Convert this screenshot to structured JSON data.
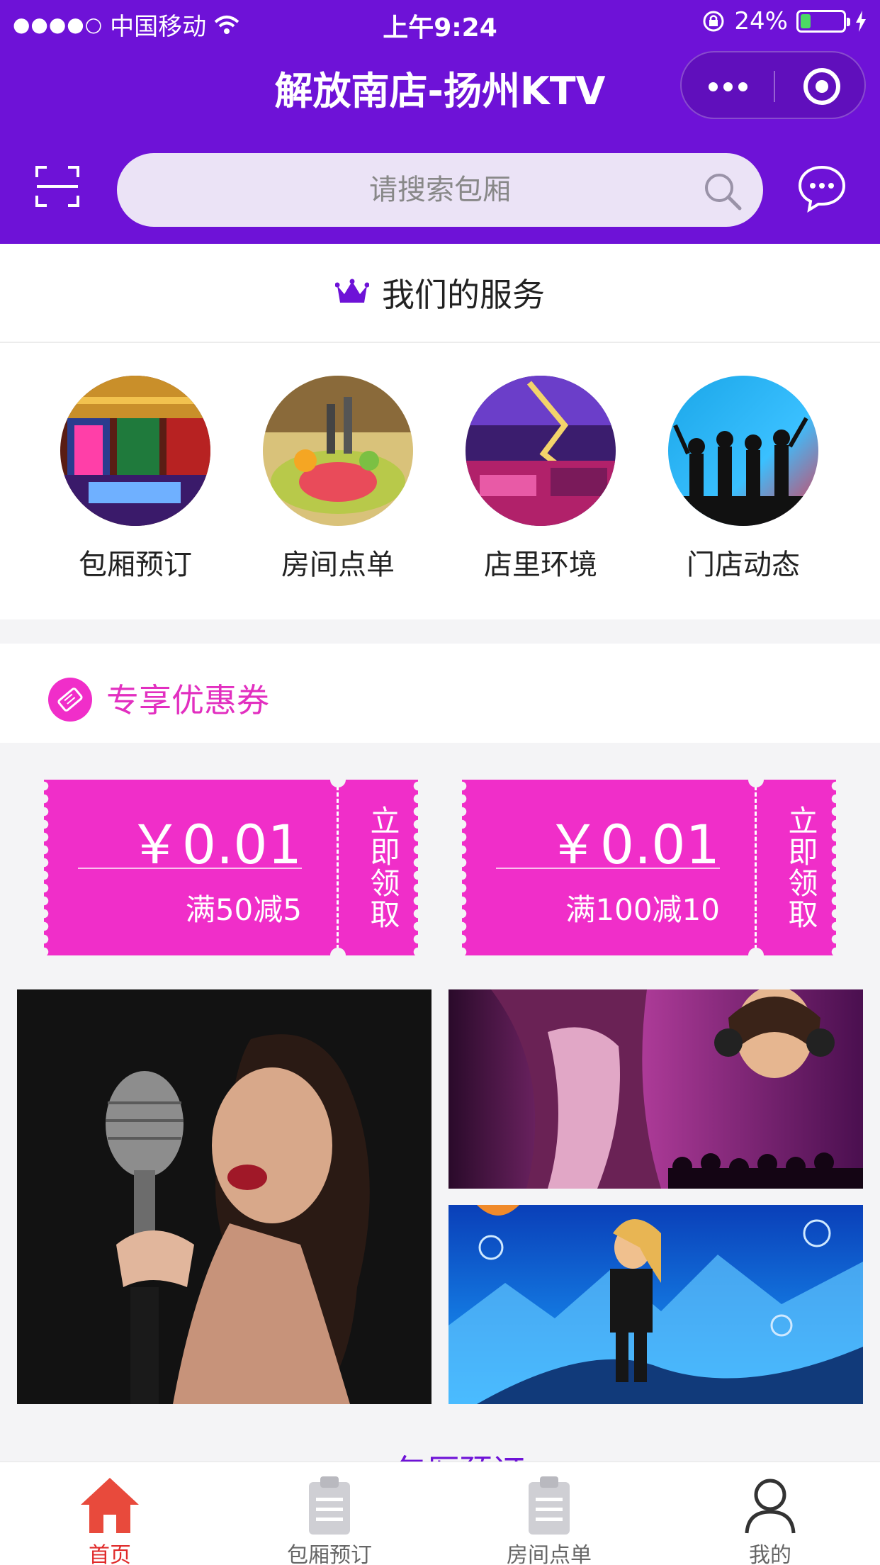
{
  "status_bar": {
    "signal": "●●●●○",
    "carrier": "中国移动",
    "time": "上午9:24",
    "battery_percent": "24%",
    "battery_level": 0.24
  },
  "header": {
    "title": "解放南店-扬州KTV",
    "accent_color": "#6e12d7"
  },
  "search": {
    "placeholder": "请搜索包厢"
  },
  "services": {
    "title": "我们的服务",
    "items": [
      {
        "label": "包厢预订",
        "icon": "ktv-room-photo"
      },
      {
        "label": "房间点单",
        "icon": "fruit-platter-photo"
      },
      {
        "label": "店里环境",
        "icon": "ktv-interior-photo"
      },
      {
        "label": "门店动态",
        "icon": "party-crowd-photo"
      }
    ]
  },
  "coupons": {
    "title": "专享优惠券",
    "accent_color": "#f02ec9",
    "items": [
      {
        "amount": "￥0.01",
        "condition": "满50减5",
        "action": "立即领取"
      },
      {
        "amount": "￥0.01",
        "condition": "满100减10",
        "action": "立即领取"
      }
    ]
  },
  "banners": [
    {
      "name": "singer-microphone-banner"
    },
    {
      "name": "party-singer-banner"
    },
    {
      "name": "ice-concert-banner"
    }
  ],
  "next_section": {
    "title": "包厢预订"
  },
  "tabbar": {
    "items": [
      {
        "label": "首页",
        "active": true,
        "icon": "home-icon"
      },
      {
        "label": "包厢预订",
        "active": false,
        "icon": "clipboard-icon"
      },
      {
        "label": "房间点单",
        "active": false,
        "icon": "clipboard-icon"
      },
      {
        "label": "我的",
        "active": false,
        "icon": "user-icon"
      }
    ],
    "active_color": "#e02b2b"
  }
}
